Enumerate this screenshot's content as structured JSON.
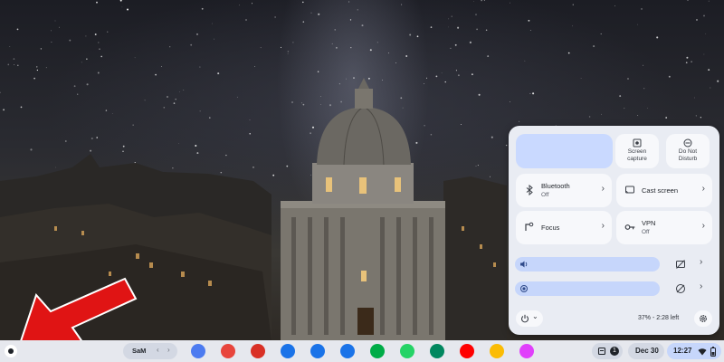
{
  "quick_settings": {
    "screen_capture": "Screen\ncapture",
    "do_not_disturb": "Do Not\nDisturb",
    "bluetooth": {
      "label": "Bluetooth",
      "status": "Off"
    },
    "cast_screen": {
      "label": "Cast screen"
    },
    "focus": {
      "label": "Focus"
    },
    "vpn": {
      "label": "VPN",
      "status": "Off"
    },
    "battery": "37% - 2:28 left",
    "icons": [
      "screen-capture-icon",
      "do-not-disturb-icon",
      "bluetooth-icon",
      "cast-icon",
      "focus-icon",
      "vpn-key-icon",
      "volume-icon",
      "brightness-icon",
      "power-icon",
      "settings-gear-icon"
    ]
  },
  "shelf": {
    "desk_name": "SaM",
    "apps": [
      {
        "name": "gemini",
        "color": "#4c7bf0"
      },
      {
        "name": "chrome",
        "color": "#e8453c"
      },
      {
        "name": "gmail",
        "color": "#d93025"
      },
      {
        "name": "calendar",
        "color": "#1a73e8"
      },
      {
        "name": "files",
        "color": "#1a73e8"
      },
      {
        "name": "messages",
        "color": "#1a73e8"
      },
      {
        "name": "meet",
        "color": "#00ac47"
      },
      {
        "name": "whatsapp",
        "color": "#25d366"
      },
      {
        "name": "play-store",
        "color": "#01875f"
      },
      {
        "name": "youtube",
        "color": "#ff0000"
      },
      {
        "name": "photos",
        "color": "#fbbc04"
      },
      {
        "name": "pink-app",
        "color": "#e040fb"
      }
    ],
    "notification_count": "1",
    "date": "Dec 30",
    "time": "12:27"
  },
  "colors": {
    "accent": "#c6d6fb",
    "annotation": "#e01414"
  }
}
